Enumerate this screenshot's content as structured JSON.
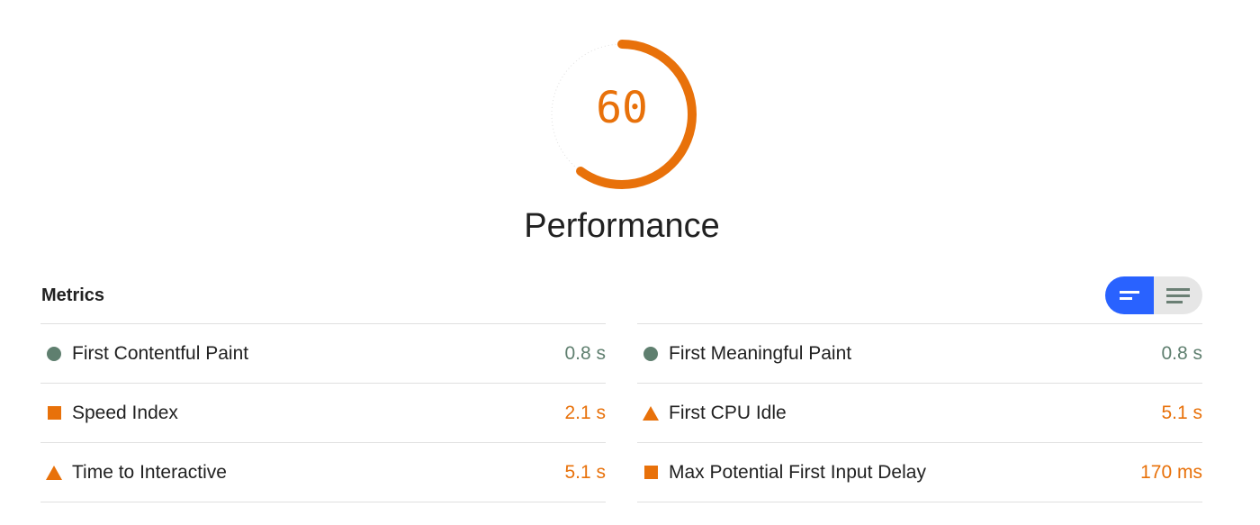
{
  "gauge": {
    "score": "60",
    "fraction": 0.6,
    "color": "#e8710a",
    "label": "Performance"
  },
  "metrics": {
    "title": "Metrics",
    "toggle": {
      "active": "compact-view",
      "options": [
        "compact-view",
        "expanded-view"
      ],
      "active_color": "#2962ff"
    },
    "left": [
      {
        "icon": "circle-icon",
        "status": "pass",
        "label": "First Contentful Paint",
        "value": "0.8 s"
      },
      {
        "icon": "square-icon",
        "status": "average",
        "label": "Speed Index",
        "value": "2.1 s"
      },
      {
        "icon": "triangle-icon",
        "status": "average",
        "label": "Time to Interactive",
        "value": "5.1 s"
      }
    ],
    "right": [
      {
        "icon": "circle-icon",
        "status": "pass",
        "label": "First Meaningful Paint",
        "value": "0.8 s"
      },
      {
        "icon": "triangle-icon",
        "status": "average",
        "label": "First CPU Idle",
        "value": "5.1 s"
      },
      {
        "icon": "square-icon",
        "status": "average",
        "label": "Max Potential First Input Delay",
        "value": "170 ms"
      }
    ]
  }
}
